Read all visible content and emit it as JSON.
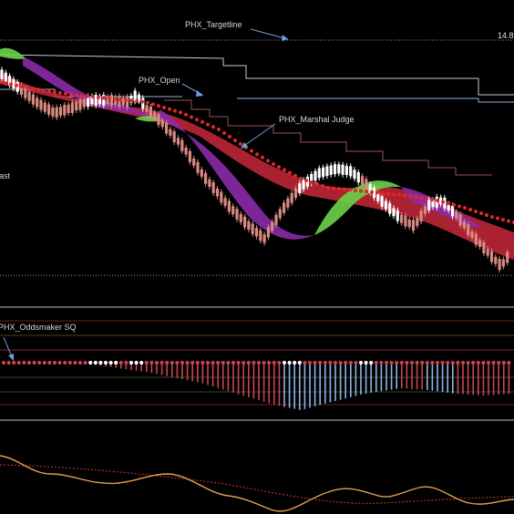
{
  "chart_data": [
    {
      "type": "line",
      "panel": "price",
      "annotations": {
        "targetline": "PHX_Targetline",
        "open": "PHX_Open",
        "marshal": "PHX_Marshal Judge",
        "left_cut": "ast"
      },
      "price_label": "14.8",
      "colors": {
        "candle_up": "#ffffff",
        "candle_down": "#d98a80",
        "ribbon_bull": "#6cd34a",
        "ribbon_bear": "#8a2aa8",
        "ribbon_band": "#c8283a",
        "dots": "#e02828",
        "targetline": "#ffffff",
        "open_line": "#8fb4d8",
        "marshal_line": "#a05050"
      }
    },
    {
      "type": "bar",
      "panel": "oscillator",
      "title": "PHX_Oddsmaker SQ",
      "colors": {
        "positive": "#ffffff",
        "negative": "#c84450",
        "neutral": "#8fb4e8"
      }
    },
    {
      "type": "line",
      "panel": "lower",
      "colors": {
        "main": "#e6a050",
        "signal": "#b03030"
      }
    }
  ]
}
